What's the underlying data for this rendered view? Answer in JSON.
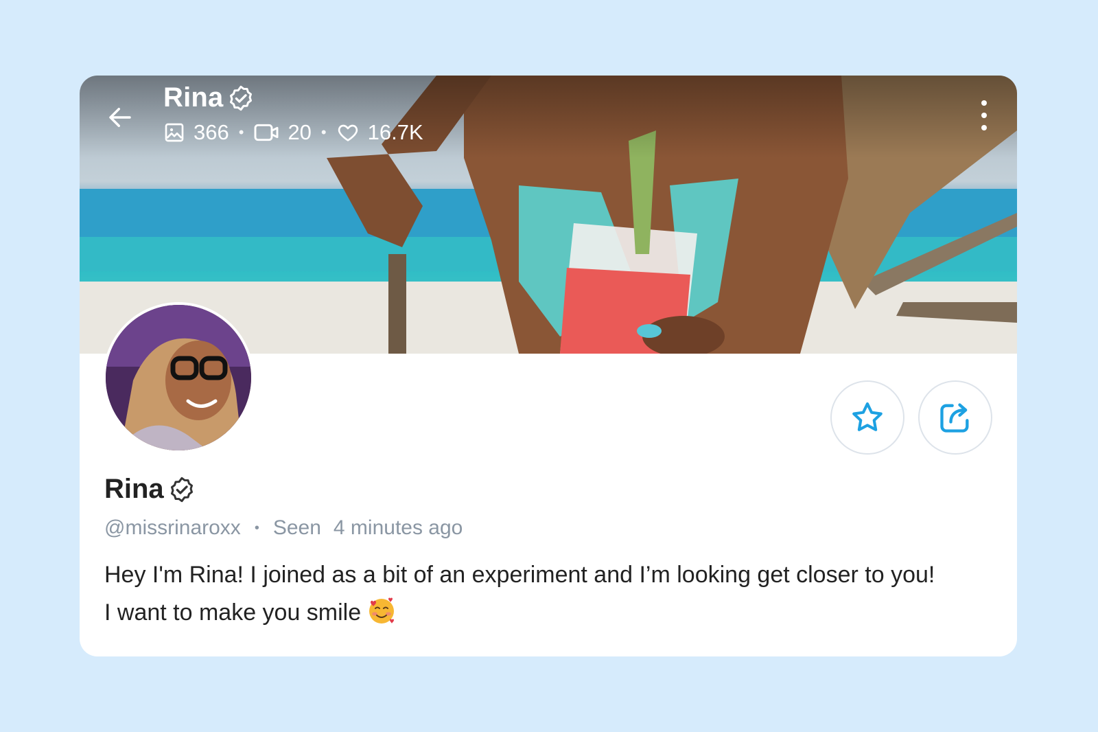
{
  "header": {
    "name": "Rina",
    "stats": {
      "photos": "366",
      "videos": "20",
      "likes": "16.7K"
    }
  },
  "profile": {
    "name": "Rina",
    "handle": "@missrinaroxx",
    "seen_label": "Seen",
    "seen_time": "4 minutes ago",
    "bio_line1": "Hey I'm Rina! I joined as a bit of an experiment and I’m looking get closer to you!",
    "bio_line2": "I want to make you smile"
  },
  "icons": {
    "back": "arrow-left-icon",
    "verified": "verified-badge-icon",
    "photos": "image-icon",
    "videos": "video-camera-icon",
    "likes": "heart-icon",
    "more": "more-vertical-icon",
    "favorite": "star-icon",
    "share": "share-icon",
    "emoji": "smiling-face-with-hearts-emoji"
  },
  "colors": {
    "background": "#d6ebfc",
    "accent": "#1da1e2",
    "muted_text": "#8a96a3",
    "text": "#222222"
  }
}
